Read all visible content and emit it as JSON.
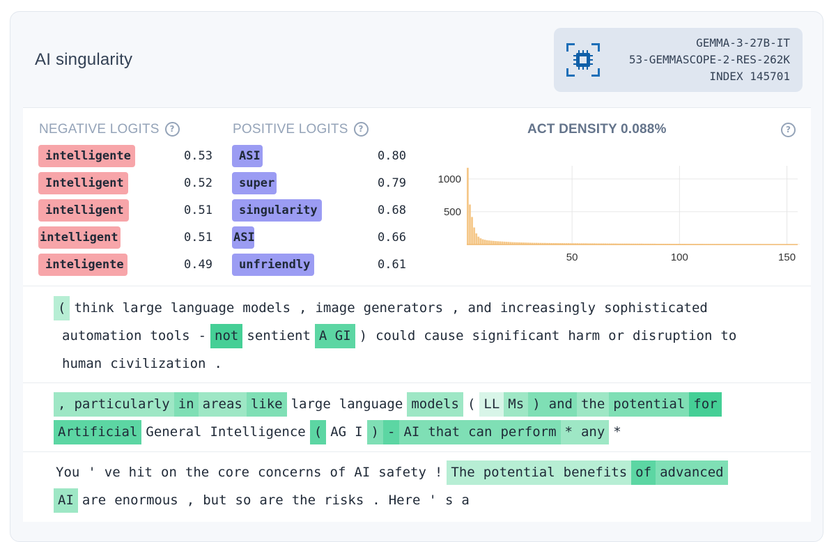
{
  "header": {
    "title": "AI singularity",
    "model": "GEMMA-3-27B-IT",
    "sae": "53-GEMMASCOPE-2-RES-262K",
    "index": "INDEX 145701"
  },
  "negative_logits": {
    "heading": "NEGATIVE LOGITS",
    "items": [
      {
        "token": "intelligente",
        "value": "0.53"
      },
      {
        "token": "Intelligent",
        "value": "0.52"
      },
      {
        "token": "intelligent",
        "value": "0.51"
      },
      {
        "token": "intelligent",
        "value": "0.51"
      },
      {
        "token": "inteligente",
        "value": "0.49"
      }
    ]
  },
  "positive_logits": {
    "heading": "POSITIVE LOGITS",
    "items": [
      {
        "token": "ASI",
        "value": "0.80"
      },
      {
        "token": "super",
        "value": "0.79"
      },
      {
        "token": "singularity",
        "value": "0.68"
      },
      {
        "token": "ASI",
        "value": "0.66"
      },
      {
        "token": "unfriendly",
        "value": "0.61"
      }
    ]
  },
  "density": {
    "label": "ACT DENSITY 0.088%"
  },
  "chart_data": {
    "type": "bar",
    "x_ticks": [
      50,
      100,
      150
    ],
    "y_ticks": [
      500,
      1000
    ],
    "xlim": [
      1,
      155
    ],
    "ylim": [
      0,
      1200
    ],
    "bar_color": "#f5c88a",
    "x": [
      1,
      2,
      3,
      4,
      5,
      6,
      7,
      8,
      9,
      10,
      11,
      12,
      13,
      14,
      15,
      16,
      17,
      18,
      19,
      20,
      21,
      22,
      23,
      24,
      25,
      26,
      27,
      28,
      29,
      30,
      31,
      32,
      33,
      34,
      35,
      36,
      37,
      38,
      39,
      40,
      41,
      42,
      43,
      44,
      45,
      46,
      47,
      48,
      49,
      50,
      51,
      52,
      53,
      54,
      55,
      56,
      57,
      58,
      59,
      60,
      61,
      62,
      63,
      64,
      65,
      66,
      67,
      68,
      69,
      70,
      71,
      72,
      73,
      74,
      75,
      76,
      77,
      78,
      79,
      80,
      81,
      82,
      83,
      84,
      85,
      86,
      87,
      88,
      89,
      90,
      91,
      92,
      93,
      94,
      95,
      96,
      97,
      98,
      99,
      100,
      101,
      102,
      103,
      104,
      105,
      106,
      107,
      108,
      109,
      110,
      111,
      112,
      113,
      114,
      115,
      116,
      117,
      118,
      119,
      120,
      121,
      122,
      123,
      124,
      125,
      126,
      127,
      128,
      129,
      130,
      131,
      132,
      133,
      134,
      135,
      136,
      137,
      138,
      139,
      140,
      141,
      142,
      143,
      144,
      145,
      146,
      147,
      148,
      149,
      150,
      151,
      152,
      153,
      154,
      155
    ],
    "values": [
      1170,
      610,
      420,
      260,
      170,
      120,
      95,
      80,
      72,
      66,
      62,
      58,
      55,
      52,
      50,
      48,
      46,
      44,
      42,
      40,
      38,
      36,
      35,
      34,
      33,
      32,
      31,
      30,
      29,
      28,
      27,
      26,
      26,
      25,
      25,
      24,
      24,
      23,
      23,
      22,
      22,
      22,
      21,
      21,
      21,
      20,
      20,
      20,
      19,
      19,
      19,
      19,
      18,
      18,
      18,
      18,
      17,
      17,
      17,
      17,
      16,
      16,
      16,
      16,
      16,
      15,
      15,
      15,
      15,
      15,
      14,
      14,
      14,
      14,
      14,
      14,
      13,
      13,
      13,
      13,
      13,
      13,
      12,
      12,
      12,
      12,
      12,
      12,
      11,
      11,
      11,
      11,
      11,
      11,
      11,
      10,
      10,
      10,
      10,
      10,
      10,
      10,
      9,
      9,
      9,
      9,
      9,
      9,
      9,
      9,
      8,
      8,
      8,
      8,
      8,
      8,
      8,
      8,
      7,
      7,
      7,
      7,
      7,
      7,
      7,
      7,
      7,
      6,
      6,
      6,
      6,
      6,
      6,
      6,
      6,
      6,
      6,
      5,
      5,
      5,
      5,
      5,
      5,
      5,
      5,
      5,
      5,
      5,
      4,
      4,
      4,
      4,
      4,
      4,
      4
    ]
  },
  "examples": [
    {
      "lines": [
        [
          [
            "(",
            2
          ],
          [
            "think",
            0
          ],
          [
            "large",
            0
          ],
          [
            "language",
            0
          ],
          [
            "models",
            0
          ],
          [
            ",",
            0
          ],
          [
            "image",
            0
          ],
          [
            "generators",
            0
          ],
          [
            ",",
            0
          ],
          [
            "and",
            0
          ],
          [
            "increasingly",
            0
          ],
          [
            "sophisticated",
            0
          ]
        ],
        [
          [
            "automation",
            0
          ],
          [
            "tools",
            0
          ],
          [
            "-",
            0
          ],
          [
            "not",
            6
          ],
          [
            "sentient",
            0
          ],
          [
            "A GI",
            5
          ],
          [
            ")",
            0
          ],
          [
            "could",
            0
          ],
          [
            "cause",
            0
          ],
          [
            "significant",
            0
          ],
          [
            "harm",
            0
          ],
          [
            "or",
            0
          ],
          [
            "disruption",
            0
          ],
          [
            "to",
            0
          ]
        ],
        [
          [
            "human",
            0
          ],
          [
            "civilization",
            0
          ],
          [
            ".",
            0
          ]
        ]
      ]
    },
    {
      "lines": [
        [
          [
            ",",
            3
          ],
          [
            "particularly",
            3
          ],
          [
            "in",
            4
          ],
          [
            "areas",
            3
          ],
          [
            "like",
            4
          ],
          [
            "large",
            0
          ],
          [
            "language",
            0
          ],
          [
            "models",
            3
          ],
          [
            "(",
            0
          ],
          [
            "LL",
            1
          ],
          [
            "Ms",
            3
          ],
          [
            ")",
            4
          ],
          [
            "and",
            4
          ],
          [
            "the",
            3
          ],
          [
            "potential",
            4
          ],
          [
            "for",
            6
          ]
        ],
        [
          [
            "Artificial",
            5
          ],
          [
            "General",
            0
          ],
          [
            "Intelligence",
            0
          ],
          [
            "(",
            5
          ],
          [
            "AG",
            0
          ],
          [
            "I",
            0
          ],
          [
            ")",
            4
          ],
          [
            "-",
            5
          ],
          [
            "AI",
            4
          ],
          [
            "that",
            4
          ],
          [
            "can",
            4
          ],
          [
            "perform",
            4
          ],
          [
            "*",
            3
          ],
          [
            "any",
            3
          ],
          [
            "*",
            0
          ]
        ]
      ]
    },
    {
      "lines": [
        [
          [
            "You",
            0
          ],
          [
            "'",
            0
          ],
          [
            "ve",
            0
          ],
          [
            "hit",
            0
          ],
          [
            "on",
            0
          ],
          [
            "the",
            0
          ],
          [
            "core",
            0
          ],
          [
            "concerns",
            0
          ],
          [
            "of",
            0
          ],
          [
            "AI",
            0
          ],
          [
            "safety",
            0
          ],
          [
            "!",
            0
          ],
          [
            "The",
            2
          ],
          [
            "potential",
            2
          ],
          [
            "benefits",
            2
          ],
          [
            "of",
            5
          ],
          [
            "advanced",
            4
          ]
        ],
        [
          [
            "AI",
            3
          ],
          [
            "are",
            0
          ],
          [
            "enormous",
            0
          ],
          [
            ",",
            0
          ],
          [
            "but",
            0
          ],
          [
            "so",
            0
          ],
          [
            "are",
            0
          ],
          [
            "the",
            0
          ],
          [
            "risks",
            0
          ],
          [
            ".",
            0
          ],
          [
            "Here",
            0
          ],
          [
            "'",
            0
          ],
          [
            "s",
            0
          ],
          [
            "a",
            0
          ]
        ]
      ]
    }
  ]
}
